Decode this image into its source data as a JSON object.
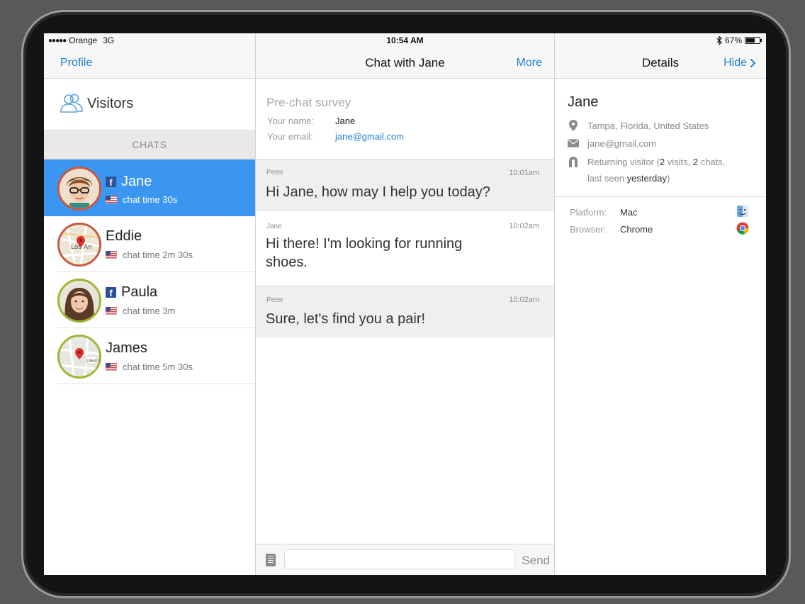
{
  "status_bar": {
    "carrier": "Orange",
    "network": "3G",
    "time": "10:54 AM",
    "battery": "67%",
    "battery_level": 0.67
  },
  "left_panel": {
    "nav_button": "Profile",
    "visitors_label": "Visitors",
    "chats_header": "CHATS",
    "chats": [
      {
        "name": "Jane",
        "time": "chat time 30s",
        "facebook": true
      },
      {
        "name": "Eddie",
        "time": "chat time 2m 30s",
        "facebook": false
      },
      {
        "name": "Paula",
        "time": "chat time 3m",
        "facebook": true
      },
      {
        "name": "James",
        "time": "chat time 5m 30s",
        "facebook": false
      }
    ]
  },
  "chat_panel": {
    "title": "Chat with Jane",
    "more_button": "More",
    "survey": {
      "title": "Pre-chat survey",
      "name_label": "Your name:",
      "name_value": "Jane",
      "email_label": "Your email:",
      "email_value": "jane@gmail.com"
    },
    "messages": [
      {
        "author": "Peter",
        "time": "10:01am",
        "text": "Hi Jane, how may I help you today?"
      },
      {
        "author": "Jane",
        "time": "10:02am",
        "text": "Hi there! I'm looking for running shoes."
      },
      {
        "author": "Peter",
        "time": "10:02am",
        "text": "Sure, let's find you a pair!"
      }
    ],
    "input_placeholder": "",
    "send_button": "Send"
  },
  "details_panel": {
    "title": "Details",
    "hide_button": "Hide",
    "visitor_name": "Jane",
    "location": "Tampa, Florida, United States",
    "email": "jane@gmail.com",
    "returning": {
      "prefix": "Returning visitor (",
      "visits": "2",
      "visits_label": " visits, ",
      "chats": "2",
      "chats_label": " chats,",
      "seen_prefix": "last seen ",
      "seen": "yesterday",
      "suffix": ")"
    },
    "platform_label": "Platform:",
    "platform_value": "Mac",
    "browser_label": "Browser:",
    "browser_value": "Chrome"
  },
  "colors": {
    "accent": "#1e7fd6",
    "active_row": "#3a96f0",
    "facebook": "#2c4f96"
  }
}
